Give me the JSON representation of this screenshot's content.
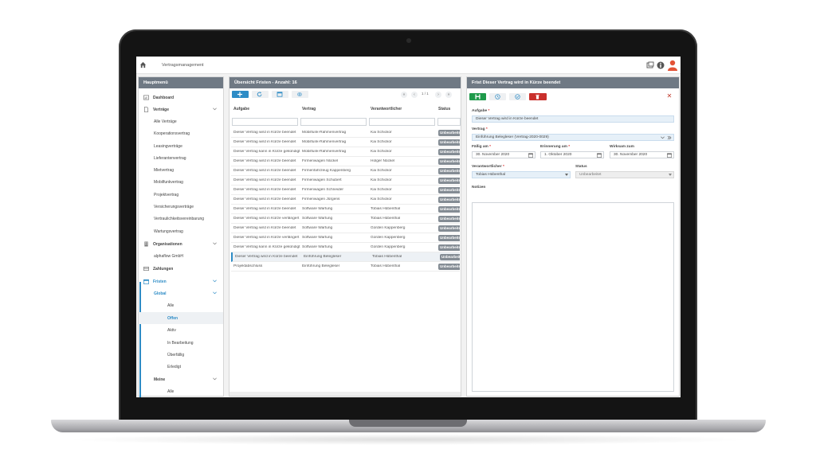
{
  "colors": {
    "header": "#6f7984",
    "accent": "#2d8cc6",
    "badge": "#848c94",
    "save": "#1f9a4b",
    "delete": "#c9302c"
  },
  "topbar": {
    "title": "Vertragsmanagement",
    "icons": [
      "home-icon",
      "window-icon",
      "info-icon",
      "user-avatar-icon"
    ]
  },
  "sidebar": {
    "title": "Hauptmenü",
    "items": [
      {
        "label": "Dashboard",
        "icon": "dashboard-icon"
      },
      {
        "label": "Verträge",
        "icon": "document-icon",
        "expanded": true
      },
      {
        "label": "Alle Verträge"
      },
      {
        "label": "Kooperationsvertrag"
      },
      {
        "label": "Leasingverträge"
      },
      {
        "label": "Lieferantenvertrag"
      },
      {
        "label": "Mietvertrag"
      },
      {
        "label": "Mobilfunkvertrag"
      },
      {
        "label": "Projektvertrag"
      },
      {
        "label": "Versicherungsverträge"
      },
      {
        "label": "Vertraulichkeitsvereinbarung"
      },
      {
        "label": "Wartungsvertrag"
      },
      {
        "label": "Organisationen",
        "icon": "building-icon"
      },
      {
        "label": "alphaflow GmbH"
      },
      {
        "label": "Zahlungen",
        "icon": "payment-icon"
      },
      {
        "label": "Fristen",
        "icon": "calendar-icon",
        "expanded": true
      },
      {
        "label": "Global"
      },
      {
        "label": "Alle"
      },
      {
        "label": "Offen"
      },
      {
        "label": "Aktiv"
      },
      {
        "label": "In Bearbeitung"
      },
      {
        "label": "Überfällig"
      },
      {
        "label": "Erledigt"
      },
      {
        "label": "Meine"
      },
      {
        "label": "Alle"
      }
    ]
  },
  "list": {
    "title": "Übersicht Fristen - Anzahl: 16",
    "pager": "1 / 1",
    "columns": [
      "Aufgabe",
      "Vertrag",
      "Verantwortlicher",
      "Status"
    ],
    "rows": [
      {
        "aufgabe": "Dieser Vertrag wird in Kürze beendet",
        "vertrag": "Mobilfunk-Rahmenvertrag",
        "verantwortlicher": "Kai Schickor",
        "status": "Unbearbeitet"
      },
      {
        "aufgabe": "Dieser Vertrag wird in Kürze beendet",
        "vertrag": "Mobilfunk-Rahmenvertrag",
        "verantwortlicher": "Kai Schickor",
        "status": "Unbearbeitet"
      },
      {
        "aufgabe": "Dieser Vertrag kann in Kürze gekündigt werden",
        "vertrag": "Mobilfunk-Rahmenvertrag",
        "verantwortlicher": "Kai Schickor",
        "status": "Unbearbeitet"
      },
      {
        "aufgabe": "Dieser Vertrag wird in Kürze beendet",
        "vertrag": "Firmenwagen Nückel",
        "verantwortlicher": "Holger Nückel",
        "status": "Unbearbeitet"
      },
      {
        "aufgabe": "Dieser Vertrag wird in Kürze beendet",
        "vertrag": "Firmenfahrzeug Kappenberg",
        "verantwortlicher": "Kai Schickor",
        "status": "Unbearbeitet"
      },
      {
        "aufgabe": "Dieser Vertrag wird in Kürze beendet",
        "vertrag": "Firmenwagen Schubert",
        "verantwortlicher": "Kai Schickor",
        "status": "Unbearbeitet"
      },
      {
        "aufgabe": "Dieser Vertrag wird in Kürze beendet",
        "vertrag": "Firmenwagen Schneider",
        "verantwortlicher": "Kai Schickor",
        "status": "Unbearbeitet"
      },
      {
        "aufgabe": "Dieser Vertrag wird in Kürze beendet",
        "vertrag": "Firmenwagen Jürgens",
        "verantwortlicher": "Kai Schickor",
        "status": "Unbearbeitet"
      },
      {
        "aufgabe": "Dieser Vertrag wird in Kürze beendet",
        "vertrag": "Software Wartung",
        "verantwortlicher": "Tobias Hübenthal",
        "status": "Unbearbeitet"
      },
      {
        "aufgabe": "Dieser Vertrag wird in Kürze verlängert",
        "vertrag": "Software Wartung",
        "verantwortlicher": "Tobias Hübenthal",
        "status": "Unbearbeitet"
      },
      {
        "aufgabe": "Dieser Vertrag wird in Kürze beendet",
        "vertrag": "Software Wartung",
        "verantwortlicher": "Gorden Kappenberg",
        "status": "Unbearbeitet"
      },
      {
        "aufgabe": "Dieser Vertrag wird in Kürze verlängert",
        "vertrag": "Software Wartung",
        "verantwortlicher": "Gorden Kappenberg",
        "status": "Unbearbeitet"
      },
      {
        "aufgabe": "Dieser Vertrag kann in Kürze gekündigt werden",
        "vertrag": "Software Wartung",
        "verantwortlicher": "Gorden Kappenberg",
        "status": "Unbearbeitet"
      },
      {
        "aufgabe": "Dieser Vertrag wird in Kürze beendet",
        "vertrag": "Einführung Belegleser",
        "verantwortlicher": "Tobias Hübenthal",
        "status": "Unbearbeitet",
        "selected": true
      },
      {
        "aufgabe": "Projektabschluss",
        "vertrag": "Einführung Belegleser",
        "verantwortlicher": "Tobias Hübenthal",
        "status": "Unbearbeitet"
      }
    ]
  },
  "detail": {
    "title": "Frist Dieser Vertrag wird in Kürze beendet",
    "fields": {
      "aufgabe_label": "Aufgabe",
      "aufgabe_value": "Dieser Vertrag wird in Kürze beendet",
      "vertrag_label": "Vertrag",
      "vertrag_value": "Einführung Belegleser (Vertrag-2020-0029)",
      "faellig_label": "Fällig am",
      "faellig_value": "30. November 2020",
      "erinnerung_label": "Erinnerung am",
      "erinnerung_value": "1. Oktober 2020",
      "wirksam_label": "Wirksam zum",
      "wirksam_value": "30. November 2020",
      "verantwortlicher_label": "Verantwortlicher",
      "verantwortlicher_value": "Tobias Hübenthal",
      "status_label": "Status",
      "status_value": "Unbearbeitet",
      "notizen_label": "Notizen"
    },
    "required_mark": "*",
    "close_glyph": "✕"
  }
}
